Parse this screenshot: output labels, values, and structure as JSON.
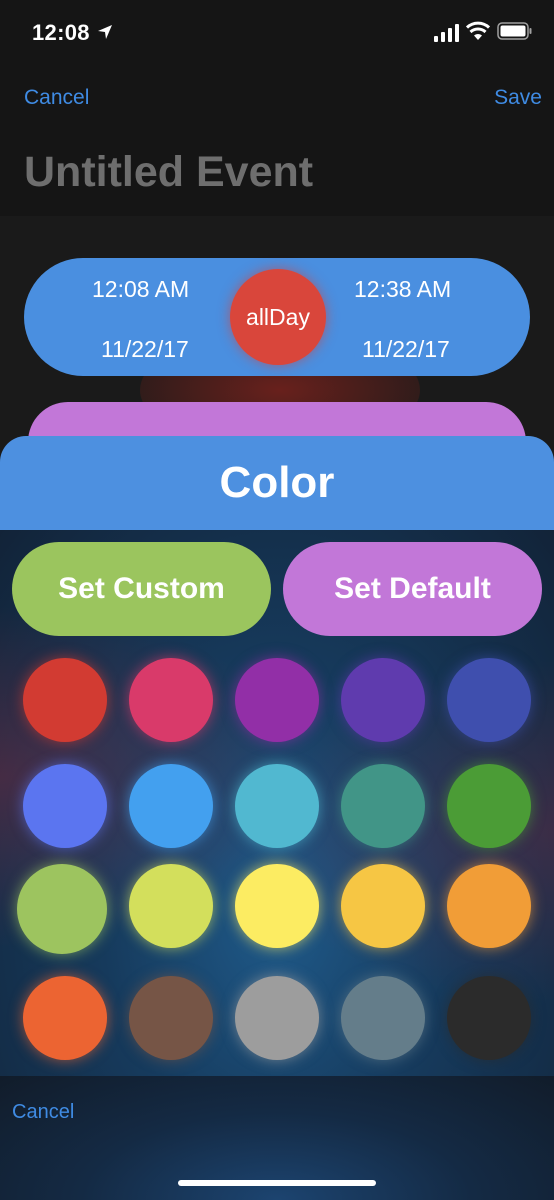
{
  "status_bar": {
    "time": "12:08"
  },
  "nav": {
    "cancel": "Cancel",
    "save": "Save"
  },
  "event": {
    "title": "Untitled Event"
  },
  "time_pill": {
    "start_time": "12:08 AM",
    "start_date": "11/22/17",
    "all_day": "allDay",
    "end_time": "12:38 AM",
    "end_date": "11/22/17",
    "color": "#4a8fe0"
  },
  "color_sheet": {
    "title": "Color",
    "set_custom": "Set Custom",
    "set_default": "Set Default",
    "swatches": [
      [
        "#d23b32",
        "#d93a6a",
        "#922fa7",
        "#5f3bae",
        "#3f4fae"
      ],
      [
        "#5b75f0",
        "#43a0ef",
        "#51b8d0",
        "#419587",
        "#4b9c36"
      ],
      [
        "#9dc45f",
        "#d3df5c",
        "#fcec62",
        "#f6c644",
        "#f19d37"
      ],
      [
        "#ec6432",
        "#765546",
        "#9d9d9d",
        "#647d8a",
        "#2b2b2b"
      ]
    ],
    "cancel": "Cancel"
  },
  "colors": {
    "accent": "#3f8be3",
    "header": "#4d90e0",
    "custom_button": "#9bc55e",
    "default_button": "#c277d8",
    "all_day": "#d9463b"
  }
}
